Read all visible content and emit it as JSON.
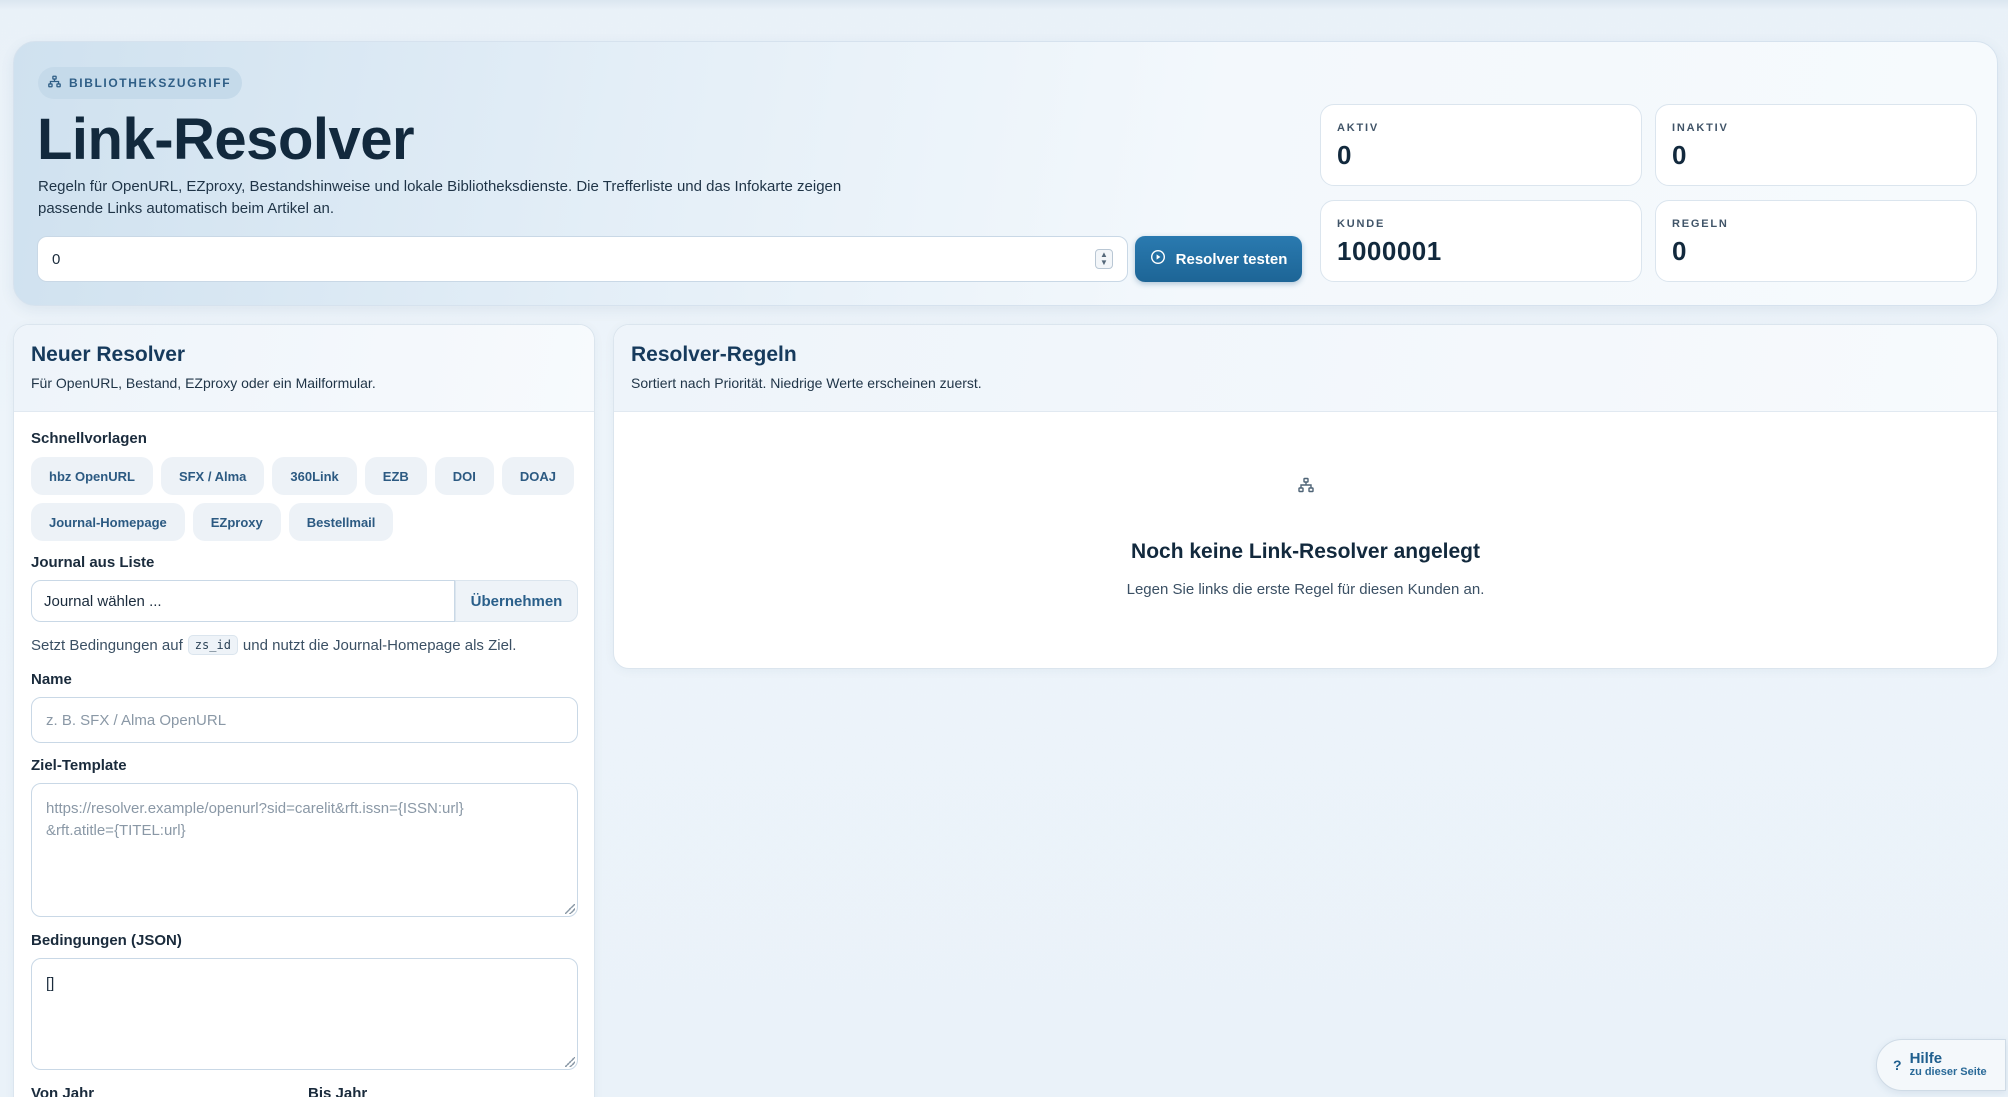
{
  "hero": {
    "badge": "BIBLIOTHEKSZUGRIFF",
    "title": "Link-Resolver",
    "description": "Regeln für OpenURL, EZproxy, Bestandshinweise und lokale Bibliotheksdienste. Die Trefferliste und das Infokarte zeigen passende Links automatisch beim Artikel an.",
    "test_input_value": "0",
    "test_button": "Resolver testen",
    "icons": {
      "badge": "sitemap-icon",
      "test_button": "play-circle-icon"
    }
  },
  "stats": [
    {
      "label": "AKTIV",
      "value": "0"
    },
    {
      "label": "INAKTIV",
      "value": "0"
    },
    {
      "label": "KUNDE",
      "value": "1000001"
    },
    {
      "label": "REGELN",
      "value": "0"
    }
  ],
  "new_resolver": {
    "title": "Neuer Resolver",
    "subtitle": "Für OpenURL, Bestand, EZproxy oder ein Mailformular.",
    "quick_templates_label": "Schnellvorlagen",
    "quick_templates": [
      "hbz OpenURL",
      "SFX / Alma",
      "360Link",
      "EZB",
      "DOI",
      "DOAJ",
      "Journal-Homepage",
      "EZproxy",
      "Bestellmail"
    ],
    "journal_label": "Journal aus Liste",
    "journal_select_value": "Journal wählen ...",
    "apply_button": "Übernehmen",
    "hint_prefix": "Setzt Bedingungen auf",
    "hint_code": "zs_id",
    "hint_suffix": "und nutzt die Journal-Homepage als Ziel.",
    "name_label": "Name",
    "name_placeholder": "z. B. SFX / Alma OpenURL",
    "target_label": "Ziel-Template",
    "target_placeholder_line1": "https://resolver.example/openurl?sid=carelit&rft.issn={ISSN:url}",
    "target_placeholder_line2": "&rft.atitle={TITEL:url}",
    "conditions_label": "Bedingungen (JSON)",
    "conditions_value": "[]",
    "from_year_label": "Von Jahr",
    "to_year_label": "Bis Jahr"
  },
  "rules": {
    "title": "Resolver-Regeln",
    "subtitle": "Sortiert nach Priorität. Niedrige Werte erscheinen zuerst.",
    "empty_title": "Noch keine Link-Resolver angelegt",
    "empty_subtitle": "Legen Sie links die erste Regel für diesen Kunden an.",
    "empty_icon": "sitemap-icon"
  },
  "help": {
    "icon": "?",
    "title": "Hilfe",
    "subtitle": "zu dieser Seite"
  },
  "colors": {
    "accent": "#1f6a9c",
    "title_dark": "#12293d",
    "chip_text": "#2c5a82"
  }
}
